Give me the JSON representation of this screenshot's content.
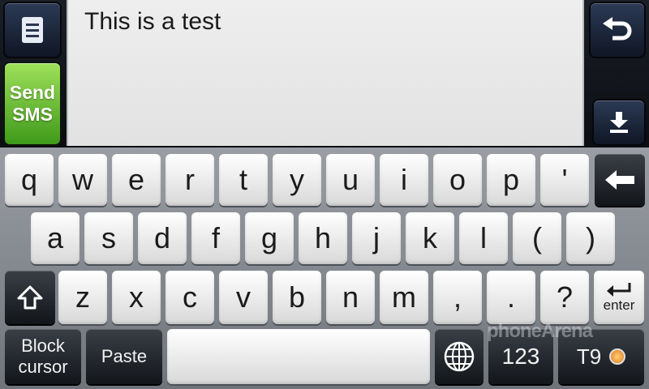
{
  "message": {
    "text": "This is a test"
  },
  "side": {
    "send_sms_label_1": "Send",
    "send_sms_label_2": "SMS"
  },
  "keyboard": {
    "row1": [
      "q",
      "w",
      "e",
      "r",
      "t",
      "y",
      "u",
      "i",
      "o",
      "p",
      "'"
    ],
    "row2": [
      "a",
      "s",
      "d",
      "f",
      "g",
      "h",
      "j",
      "k",
      "l",
      "(",
      ")"
    ],
    "row3": [
      "z",
      "x",
      "c",
      "v",
      "b",
      "n",
      "m",
      ",",
      ".",
      "?"
    ],
    "block_cursor_1": "Block",
    "block_cursor_2": "cursor",
    "paste": "Paste",
    "numbers": "123",
    "t9": "T9",
    "enter": "enter"
  },
  "watermark": "phoneArena"
}
